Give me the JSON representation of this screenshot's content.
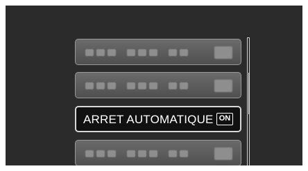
{
  "menu": {
    "items": [
      {
        "state": "disabled"
      },
      {
        "state": "disabled"
      },
      {
        "state": "selected",
        "label": "ARRET AUTOMATIQUE",
        "value": "ON"
      },
      {
        "state": "disabled"
      }
    ]
  },
  "scrollbar": {
    "position_fraction": 0.35
  }
}
